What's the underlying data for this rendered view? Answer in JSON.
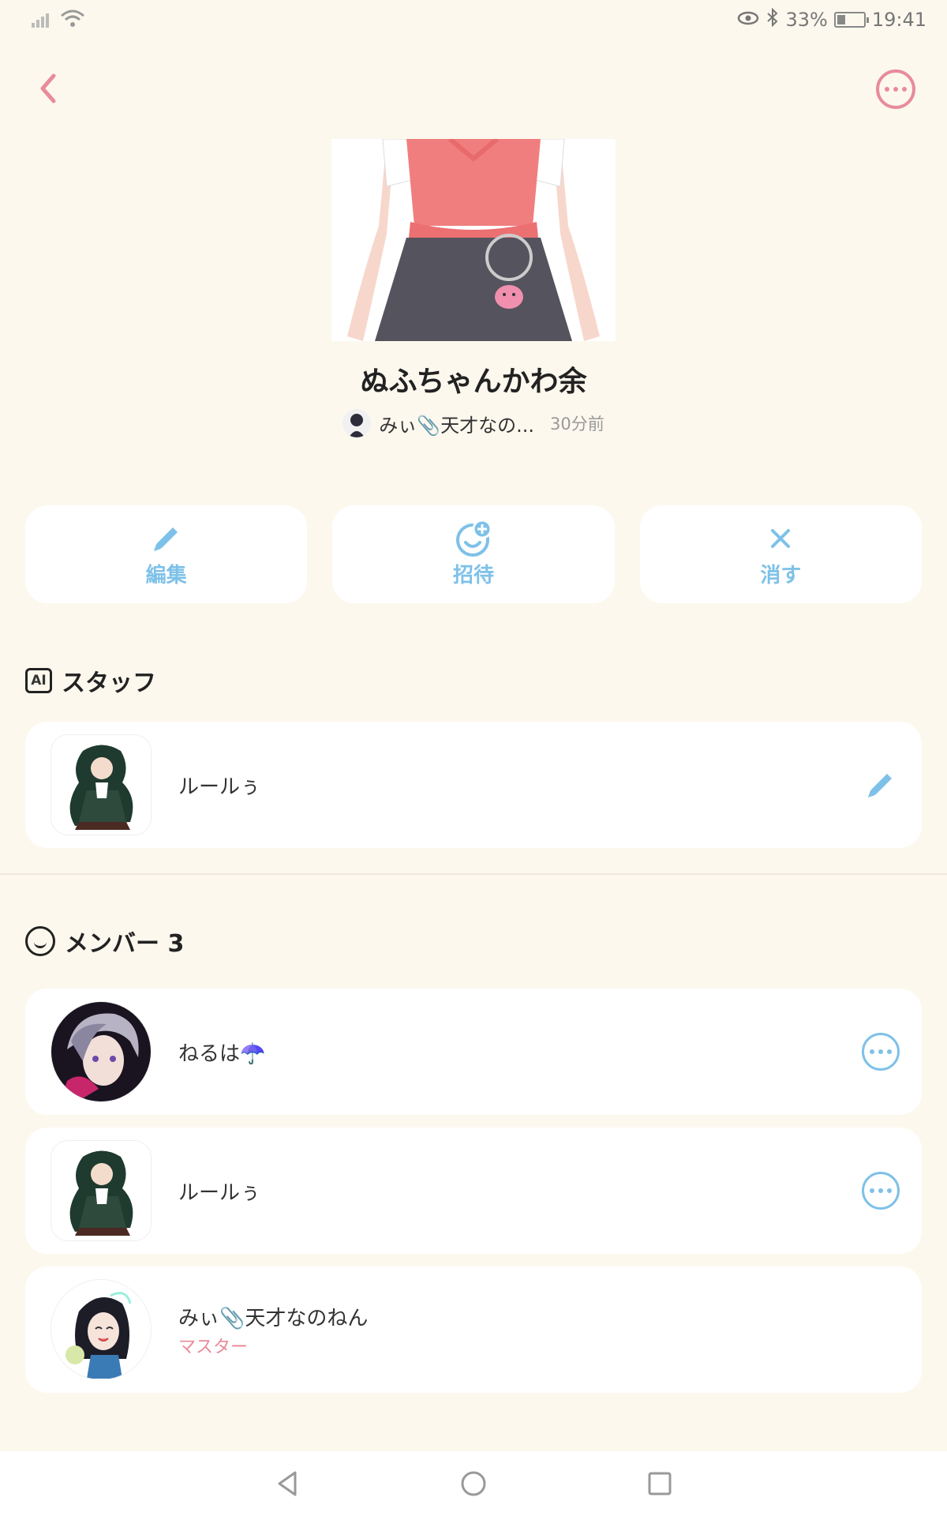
{
  "status_bar": {
    "battery": "33%",
    "battery_level": 0.33,
    "time": "19:41"
  },
  "header": {
    "back_icon": "chevron-left-icon",
    "more_icon": "more-icon"
  },
  "room": {
    "title": "ぬふちゃんかわ余",
    "owner": "みぃ📎天才なの...",
    "time": "30分前"
  },
  "actions": [
    {
      "label": "編集",
      "icon": "pencil-icon"
    },
    {
      "label": "招待",
      "icon": "invite-icon"
    },
    {
      "label": "消す",
      "icon": "close-icon"
    }
  ],
  "staff": {
    "heading_badge": "AI",
    "heading": "スタッフ",
    "items": [
      {
        "name": "ルールぅ"
      }
    ]
  },
  "members": {
    "heading": "メンバー 3",
    "items": [
      {
        "name": "ねるは☂️"
      },
      {
        "name": "ルールぅ"
      },
      {
        "name": "みぃ📎天才なのねん",
        "role": "マスター"
      }
    ]
  },
  "colors": {
    "accent_blue": "#7ec1e8",
    "accent_pink": "#e88b9a",
    "background": "#fdf8ee"
  }
}
